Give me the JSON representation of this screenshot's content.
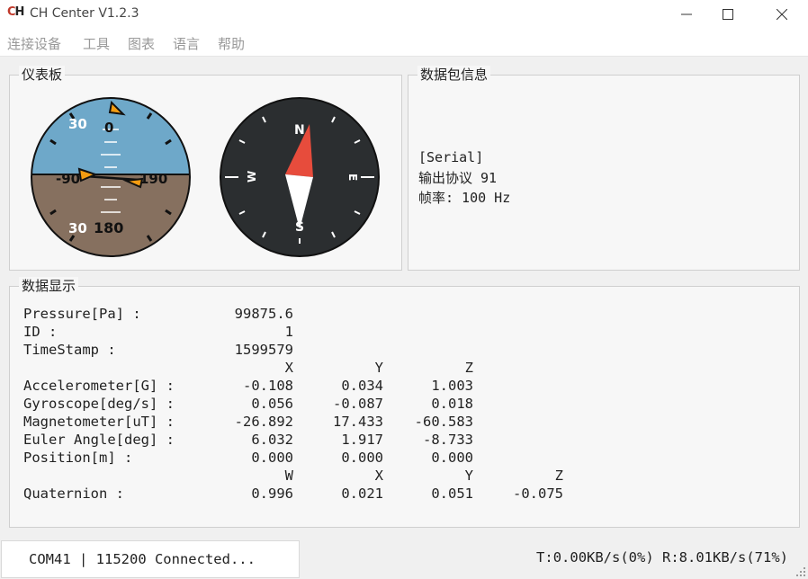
{
  "window": {
    "logo_text": "CH",
    "title": "CH Center V1.2.3",
    "minimize_glyph": "—",
    "maximize_glyph": "☐",
    "close_glyph": "✕"
  },
  "menu": [
    "连接设备",
    "工具",
    "图表",
    "语言",
    "帮助"
  ],
  "instrument_panel": {
    "title": "仪表板",
    "attitude": {
      "pitch_labels": [
        "30",
        "0",
        "-90",
        "190",
        "30",
        "180"
      ],
      "sky_color": "#6ea8c9",
      "ground_color": "#86705f",
      "marker_color": "#f39c12"
    },
    "compass": {
      "labels": [
        "N",
        "E",
        "S",
        "W"
      ],
      "face_color": "#2b2e30",
      "north_needle_color": "#e74c3c",
      "south_needle_color": "#ffffff"
    }
  },
  "packet_info": {
    "title": "数据包信息",
    "lines": [
      "[Serial]",
      "输出协议 91",
      "帧率: 100 Hz"
    ]
  },
  "data_display": {
    "title": "数据显示",
    "pressure_label": "Pressure[Pa] :",
    "pressure_value": "99875.6",
    "id_label": "ID :",
    "id_value": "1",
    "timestamp_label": "TimeStamp :",
    "timestamp_value": "1599579",
    "xyz_headers": [
      "X",
      "Y",
      "Z"
    ],
    "rows": [
      {
        "label": "Accelerometer[G] :",
        "values": [
          "-0.108",
          "0.034",
          "1.003"
        ]
      },
      {
        "label": "Gyroscope[deg/s] :",
        "values": [
          "0.056",
          "-0.087",
          "0.018"
        ]
      },
      {
        "label": "Magnetometer[uT] :",
        "values": [
          "-26.892",
          "17.433",
          "-60.583"
        ]
      },
      {
        "label": "Euler Angle[deg] :",
        "values": [
          "6.032",
          "1.917",
          "-8.733"
        ]
      },
      {
        "label": "Position[m] :",
        "values": [
          "0.000",
          "0.000",
          "0.000"
        ]
      }
    ],
    "quat_headers": [
      "W",
      "X",
      "Y",
      "Z"
    ],
    "quaternion_label": "Quaternion :",
    "quaternion_values": [
      "0.996",
      "0.021",
      "0.051",
      "-0.075"
    ]
  },
  "status": {
    "connection": "COM41 | 115200 Connected...",
    "throughput": "T:0.00KB/s(0%) R:8.01KB/s(71%)"
  }
}
